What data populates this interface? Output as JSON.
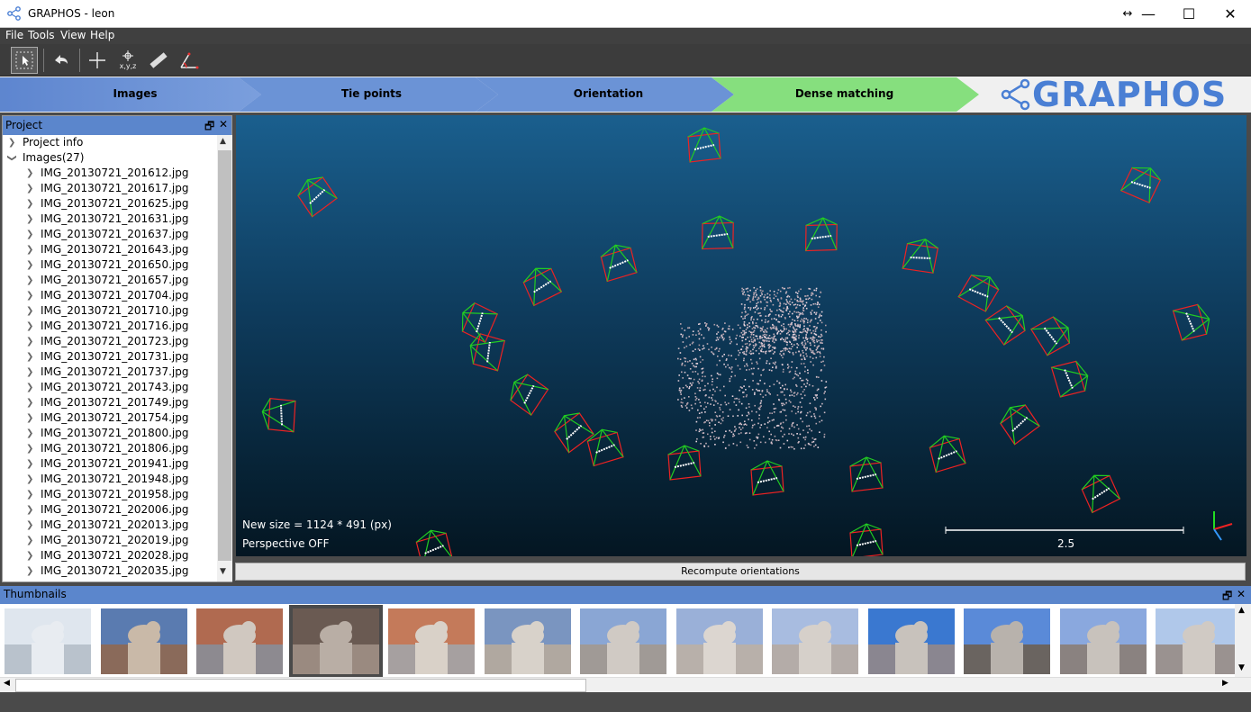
{
  "window": {
    "title": "GRAPHOS - leon",
    "min": "—",
    "max": "☐",
    "close": "✕",
    "resize": "↔"
  },
  "menu": [
    "File",
    "Tools",
    "View",
    "Help"
  ],
  "toolbar": {
    "coord_label": "x,y,z"
  },
  "steps": [
    "Images",
    "Tie points",
    "Orientation",
    "Dense matching"
  ],
  "logo": "GRAPHOS",
  "project_panel": {
    "title": "Project",
    "project_info": "Project info",
    "images_label": "Images(27)",
    "images": [
      "IMG_20130721_201612.jpg",
      "IMG_20130721_201617.jpg",
      "IMG_20130721_201625.jpg",
      "IMG_20130721_201631.jpg",
      "IMG_20130721_201637.jpg",
      "IMG_20130721_201643.jpg",
      "IMG_20130721_201650.jpg",
      "IMG_20130721_201657.jpg",
      "IMG_20130721_201704.jpg",
      "IMG_20130721_201710.jpg",
      "IMG_20130721_201716.jpg",
      "IMG_20130721_201723.jpg",
      "IMG_20130721_201731.jpg",
      "IMG_20130721_201737.jpg",
      "IMG_20130721_201743.jpg",
      "IMG_20130721_201749.jpg",
      "IMG_20130721_201754.jpg",
      "IMG_20130721_201800.jpg",
      "IMG_20130721_201806.jpg",
      "IMG_20130721_201941.jpg",
      "IMG_20130721_201948.jpg",
      "IMG_20130721_201958.jpg",
      "IMG_20130721_202006.jpg",
      "IMG_20130721_202013.jpg",
      "IMG_20130721_202019.jpg",
      "IMG_20130721_202028.jpg",
      "IMG_20130721_202035.jpg"
    ]
  },
  "viewer": {
    "size_text": "New size = 1124 * 491 (px)",
    "perspective_text": "Perspective OFF",
    "scale_value": "2.5"
  },
  "recompute_label": "Recompute orientations",
  "thumbnails_panel": {
    "title": "Thumbnails",
    "count_visible": 13,
    "selected_index": 3
  },
  "colors": {
    "step_blue": "#6b93d6",
    "step_green": "#86df7e",
    "panel_header": "#5b86cc"
  }
}
